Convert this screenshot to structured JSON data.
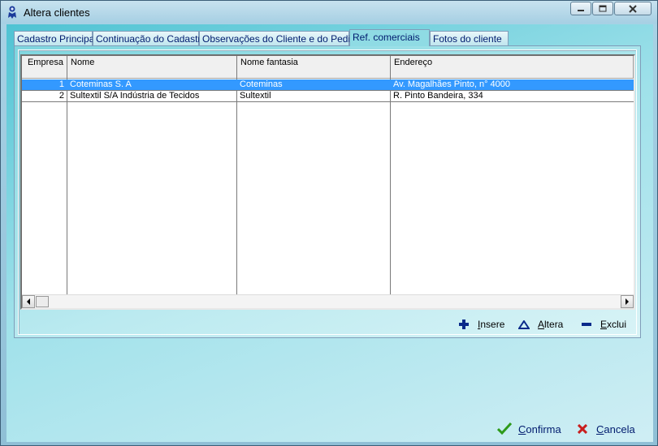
{
  "window": {
    "title": "Altera clientes",
    "icon": "person-ribbon-icon"
  },
  "tabs": [
    {
      "label": "Cadastro Principal",
      "active": false
    },
    {
      "label": "Continuação do Cadastro",
      "active": false
    },
    {
      "label": "Observações do Cliente e do Pedido",
      "active": false
    },
    {
      "label": "Ref. comerciais",
      "active": true
    },
    {
      "label": "Fotos do cliente",
      "active": false
    }
  ],
  "grid": {
    "columns": [
      "Empresa",
      "Nome",
      "Nome fantasia",
      "Endereço"
    ],
    "rows": [
      {
        "empresa": "1",
        "nome": "Coteminas S. A",
        "fantasia": "Coteminas",
        "endereco": "Av. Magalhães Pinto, n° 4000",
        "selected": true
      },
      {
        "empresa": "2",
        "nome": "Sultextil S/A Indústria de Tecidos",
        "fantasia": "Sultextil",
        "endereco": "R. Pinto Bandeira, 334",
        "selected": false
      }
    ]
  },
  "actions": {
    "insere": "Insere",
    "altera": "Altera",
    "exclui": "Exclui"
  },
  "footer": {
    "confirma": "Confirma",
    "cancela": "Cancela"
  },
  "colors": {
    "selection": "#3399ff",
    "confirm_check": "#2e9a1a",
    "cancel_x": "#c81e1e",
    "action_icon": "#0a2a8a"
  }
}
